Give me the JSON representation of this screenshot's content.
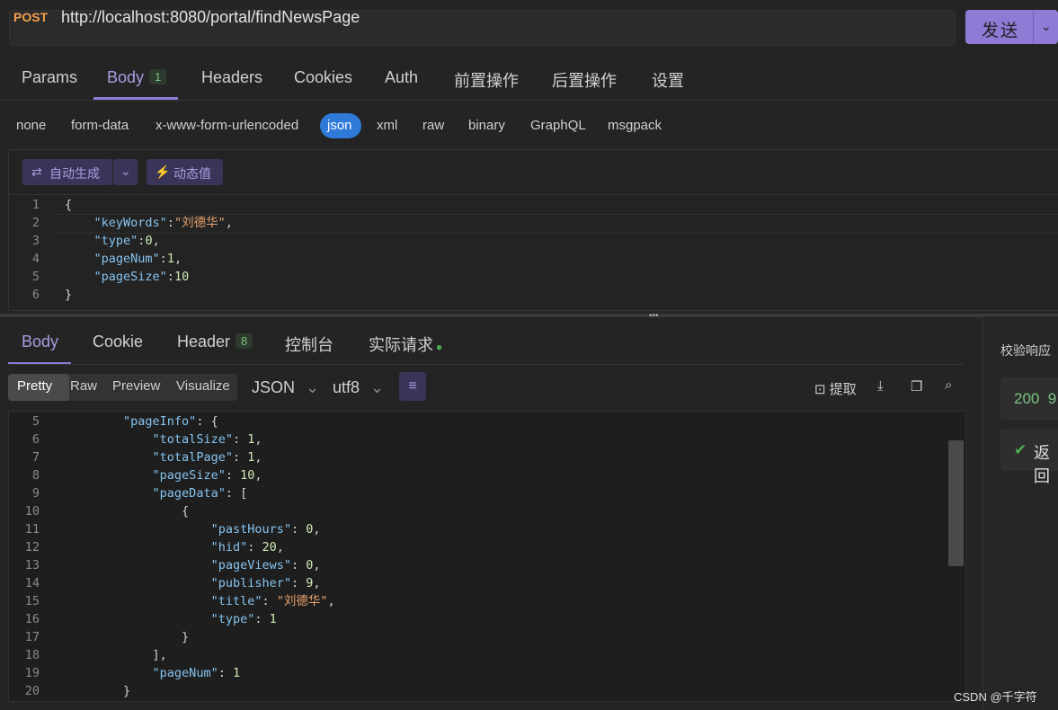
{
  "request": {
    "method": "POST",
    "url": "http://localhost:8080/portal/findNewsPage",
    "send_label": "发送"
  },
  "request_tabs": [
    {
      "label": "Params"
    },
    {
      "label": "Body",
      "badge": "1"
    },
    {
      "label": "Headers"
    },
    {
      "label": "Cookies"
    },
    {
      "label": "Auth"
    },
    {
      "label": "前置操作"
    },
    {
      "label": "后置操作"
    },
    {
      "label": "设置"
    }
  ],
  "body_types": [
    "none",
    "form-data",
    "x-www-form-urlencoded",
    "json",
    "xml",
    "raw",
    "binary",
    "GraphQL",
    "msgpack"
  ],
  "body_type_selected": "json",
  "body_toolbar": {
    "auto_generate": "自动生成",
    "dynamic_value": "动态值"
  },
  "request_body_lines": [
    {
      "n": "1",
      "parts": [
        [
          "punc",
          "{"
        ]
      ]
    },
    {
      "n": "2",
      "parts": [
        [
          "punc",
          "    "
        ],
        [
          "key",
          "\"keyWords\""
        ],
        [
          "punc",
          ":"
        ],
        [
          "str",
          "\"刘德华\""
        ],
        [
          "punc",
          ","
        ]
      ]
    },
    {
      "n": "3",
      "parts": [
        [
          "punc",
          "    "
        ],
        [
          "key",
          "\"type\""
        ],
        [
          "punc",
          ":"
        ],
        [
          "num",
          "0"
        ],
        [
          "punc",
          ","
        ]
      ]
    },
    {
      "n": "4",
      "parts": [
        [
          "punc",
          "    "
        ],
        [
          "key",
          "\"pageNum\""
        ],
        [
          "punc",
          ":"
        ],
        [
          "num",
          "1"
        ],
        [
          "punc",
          ","
        ]
      ]
    },
    {
      "n": "5",
      "parts": [
        [
          "punc",
          "    "
        ],
        [
          "key",
          "\"pageSize\""
        ],
        [
          "punc",
          ":"
        ],
        [
          "num",
          "10"
        ]
      ]
    },
    {
      "n": "6",
      "parts": [
        [
          "punc",
          "}"
        ]
      ]
    }
  ],
  "response_tabs": [
    {
      "label": "Body"
    },
    {
      "label": "Cookie"
    },
    {
      "label": "Header",
      "badge": "8"
    },
    {
      "label": "控制台"
    },
    {
      "label": "实际请求"
    }
  ],
  "view_modes": [
    "Pretty",
    "Raw",
    "Preview",
    "Visualize"
  ],
  "format_select": "JSON",
  "encoding_select": "utf8",
  "response_actions": {
    "extract": "提取"
  },
  "response_lines": [
    {
      "n": "5",
      "parts": [
        [
          "punc",
          "        "
        ],
        [
          "key",
          "\"pageInfo\""
        ],
        [
          "punc",
          ": {"
        ]
      ]
    },
    {
      "n": "6",
      "parts": [
        [
          "punc",
          "            "
        ],
        [
          "key",
          "\"totalSize\""
        ],
        [
          "punc",
          ": "
        ],
        [
          "num",
          "1"
        ],
        [
          "punc",
          ","
        ]
      ]
    },
    {
      "n": "7",
      "parts": [
        [
          "punc",
          "            "
        ],
        [
          "key",
          "\"totalPage\""
        ],
        [
          "punc",
          ": "
        ],
        [
          "num",
          "1"
        ],
        [
          "punc",
          ","
        ]
      ]
    },
    {
      "n": "8",
      "parts": [
        [
          "punc",
          "            "
        ],
        [
          "key",
          "\"pageSize\""
        ],
        [
          "punc",
          ": "
        ],
        [
          "num",
          "10"
        ],
        [
          "punc",
          ","
        ]
      ]
    },
    {
      "n": "9",
      "parts": [
        [
          "punc",
          "            "
        ],
        [
          "key",
          "\"pageData\""
        ],
        [
          "punc",
          ": ["
        ]
      ]
    },
    {
      "n": "10",
      "parts": [
        [
          "punc",
          "                {"
        ]
      ]
    },
    {
      "n": "11",
      "parts": [
        [
          "punc",
          "                    "
        ],
        [
          "key",
          "\"pastHours\""
        ],
        [
          "punc",
          ": "
        ],
        [
          "num",
          "0"
        ],
        [
          "punc",
          ","
        ]
      ]
    },
    {
      "n": "12",
      "parts": [
        [
          "punc",
          "                    "
        ],
        [
          "key",
          "\"hid\""
        ],
        [
          "punc",
          ": "
        ],
        [
          "num",
          "20"
        ],
        [
          "punc",
          ","
        ]
      ]
    },
    {
      "n": "13",
      "parts": [
        [
          "punc",
          "                    "
        ],
        [
          "key",
          "\"pageViews\""
        ],
        [
          "punc",
          ": "
        ],
        [
          "num",
          "0"
        ],
        [
          "punc",
          ","
        ]
      ]
    },
    {
      "n": "14",
      "parts": [
        [
          "punc",
          "                    "
        ],
        [
          "key",
          "\"publisher\""
        ],
        [
          "punc",
          ": "
        ],
        [
          "num",
          "9"
        ],
        [
          "punc",
          ","
        ]
      ]
    },
    {
      "n": "15",
      "parts": [
        [
          "punc",
          "                    "
        ],
        [
          "key",
          "\"title\""
        ],
        [
          "punc",
          ": "
        ],
        [
          "str",
          "\"刘德华\""
        ],
        [
          "punc",
          ","
        ]
      ]
    },
    {
      "n": "16",
      "parts": [
        [
          "punc",
          "                    "
        ],
        [
          "key",
          "\"type\""
        ],
        [
          "punc",
          ": "
        ],
        [
          "num",
          "1"
        ]
      ]
    },
    {
      "n": "17",
      "parts": [
        [
          "punc",
          "                }"
        ]
      ]
    },
    {
      "n": "18",
      "parts": [
        [
          "punc",
          "            ],"
        ]
      ]
    },
    {
      "n": "19",
      "parts": [
        [
          "punc",
          "            "
        ],
        [
          "key",
          "\"pageNum\""
        ],
        [
          "punc",
          ": "
        ],
        [
          "num",
          "1"
        ]
      ]
    },
    {
      "n": "20",
      "parts": [
        [
          "punc",
          "        }"
        ]
      ]
    }
  ],
  "right_panel": {
    "title": "校验响应",
    "status_partial": "200  9",
    "result_partial": "返回"
  },
  "watermark": "CSDN @千字符",
  "colors": {
    "accent": "#8f7ad6",
    "method": "#f2a14a",
    "json_pill": "#2f7ad8",
    "success": "#4caf50"
  }
}
